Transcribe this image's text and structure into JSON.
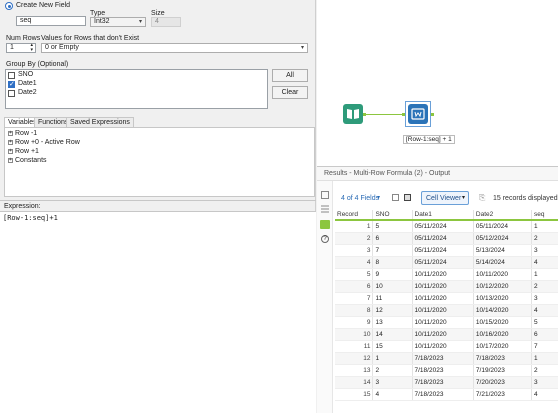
{
  "config": {
    "create_field_label": "Create New  Field",
    "field_name": "seq",
    "type_label": "Type",
    "type_value": "Int32",
    "size_label": "Size",
    "size_value": "4",
    "num_rows_label": "Num Rows",
    "num_rows_value": "1",
    "values_label": "Values for Rows that don't Exist",
    "values_value": "0 or Empty",
    "group_by_label": "Group By (Optional)",
    "group_by_items": [
      {
        "label": "SNO",
        "checked": false
      },
      {
        "label": "Date1",
        "checked": true
      },
      {
        "label": "Date2",
        "checked": false
      }
    ],
    "all_button": "All",
    "clear_button": "Clear",
    "tabs": [
      "Variables",
      "Functions",
      "Saved Expressions"
    ],
    "variables": [
      "Row -1",
      "Row +0 - Active Row",
      "Row +1",
      "Constants"
    ],
    "expression_label": "Expression:",
    "expression_text": "[Row-1:seq]+1"
  },
  "canvas": {
    "tool_annotation": "[Row-1:seq] + 1"
  },
  "results": {
    "title": "Results - Multi-Row Formula (2) - Output",
    "fields_label": "4 of 4 Fields",
    "cell_viewer_label": "Cell Viewer",
    "records_label": "15 records displayed",
    "columns": [
      "Record",
      "SNO",
      "Date1",
      "Date2",
      "seq"
    ],
    "rows": [
      [
        "1",
        "5",
        "05/11/2024",
        "05/11/2024",
        "1"
      ],
      [
        "2",
        "6",
        "05/11/2024",
        "05/12/2024",
        "2"
      ],
      [
        "3",
        "7",
        "05/11/2024",
        "5/13/2024",
        "3"
      ],
      [
        "4",
        "8",
        "05/11/2024",
        "5/14/2024",
        "4"
      ],
      [
        "5",
        "9",
        "10/11/2020",
        "10/11/2020",
        "1"
      ],
      [
        "6",
        "10",
        "10/11/2020",
        "10/12/2020",
        "2"
      ],
      [
        "7",
        "11",
        "10/11/2020",
        "10/13/2020",
        "3"
      ],
      [
        "8",
        "12",
        "10/11/2020",
        "10/14/2020",
        "4"
      ],
      [
        "9",
        "13",
        "10/11/2020",
        "10/15/2020",
        "5"
      ],
      [
        "10",
        "14",
        "10/11/2020",
        "10/16/2020",
        "6"
      ],
      [
        "11",
        "15",
        "10/11/2020",
        "10/17/2020",
        "7"
      ],
      [
        "12",
        "1",
        "7/18/2023",
        "7/18/2023",
        "1"
      ],
      [
        "13",
        "2",
        "7/18/2023",
        "7/19/2023",
        "2"
      ],
      [
        "14",
        "3",
        "7/18/2023",
        "7/20/2023",
        "3"
      ],
      [
        "15",
        "4",
        "7/18/2023",
        "7/21/2023",
        "4"
      ]
    ]
  },
  "colors": {
    "accent_green": "#8cc63f",
    "accent_blue": "#2f6fc4",
    "input_tool_green": "#2e9b7a",
    "formula_tool_blue": "#2a73b8"
  }
}
